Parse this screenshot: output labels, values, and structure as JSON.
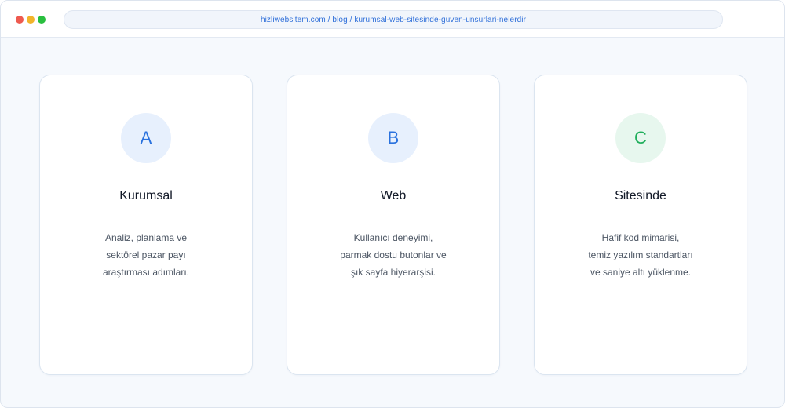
{
  "browser": {
    "url": "hizliwebsitem.com / blog / kurumsal-web-sitesinde-guven-unsurlari-nelerdir"
  },
  "cards": [
    {
      "letter": "A",
      "title": "Kurumsal",
      "description": [
        "Analiz, planlama ve",
        "sektörel pazar payı",
        "araştırması adımları."
      ],
      "accent": "#2a72de"
    },
    {
      "letter": "B",
      "title": "Web",
      "description": [
        "Kullanıcı deneyimi,",
        "parmak dostu butonlar ve",
        "şık sayfa hiyerarşisi."
      ],
      "accent": "#2a72de"
    },
    {
      "letter": "C",
      "title": "Sitesinde",
      "description": [
        "Hafif kod mimarisi,",
        "temiz yazılım standartları",
        "ve saniye altı yüklenme."
      ],
      "accent": "#1fae5b"
    }
  ]
}
